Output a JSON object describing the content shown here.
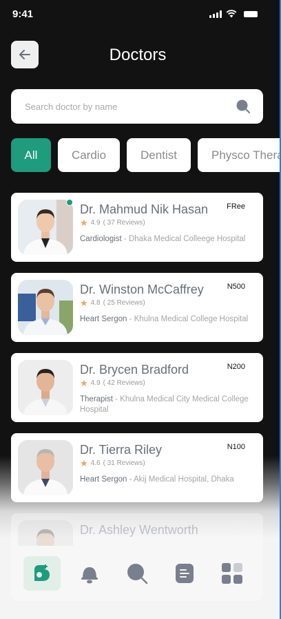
{
  "status_bar": {
    "time": "9:41"
  },
  "header": {
    "title": "Doctors"
  },
  "search": {
    "placeholder": "Search doctor by name"
  },
  "categories": [
    {
      "label": "All",
      "active": true
    },
    {
      "label": "Cardio",
      "active": false
    },
    {
      "label": "Dentist",
      "active": false
    },
    {
      "label": "Physco Therapist",
      "active": false
    }
  ],
  "doctors": [
    {
      "name": "Dr. Mahmud Nik Hasan",
      "fee": "FRee",
      "rating": "4.9",
      "reviews": "( 37 Reviews)",
      "role": "Cardiologist",
      "hospital": "Dhaka Medical Colleege Hospital",
      "online": true
    },
    {
      "name": "Dr. Winston McCaffrey",
      "fee": "N500",
      "rating": "4.8",
      "reviews": "( 25 Reviews)",
      "role": "Heart Sergon",
      "hospital": "Khulna Medical College Hospital",
      "online": false
    },
    {
      "name": "Dr. Brycen Bradford",
      "fee": "N200",
      "rating": "4.9",
      "reviews": "( 42 Reviews)",
      "role": "Therapist",
      "hospital": "Khulna Medical City Medical College Hospital",
      "online": false
    },
    {
      "name": "Dr. Tierra Riley",
      "fee": "N100",
      "rating": "4.6",
      "reviews": "( 31 Reviews)",
      "role": "Heart Sergon",
      "hospital": "Akij Medical Hospital, Dhaka",
      "online": false
    },
    {
      "name": "Dr. Ashley Wentworth",
      "fee": "",
      "rating": "",
      "reviews": "",
      "role": "",
      "hospital": "",
      "online": false
    }
  ],
  "bottom_nav": [
    {
      "icon": "doctor-logo-icon",
      "active": true
    },
    {
      "icon": "bell-icon",
      "active": false
    },
    {
      "icon": "search-icon",
      "active": false
    },
    {
      "icon": "document-icon",
      "active": false
    },
    {
      "icon": "grid-icon",
      "active": false
    }
  ],
  "colors": {
    "accent": "#1f9b7d",
    "background": "#121212",
    "star": "#f1a35e"
  }
}
